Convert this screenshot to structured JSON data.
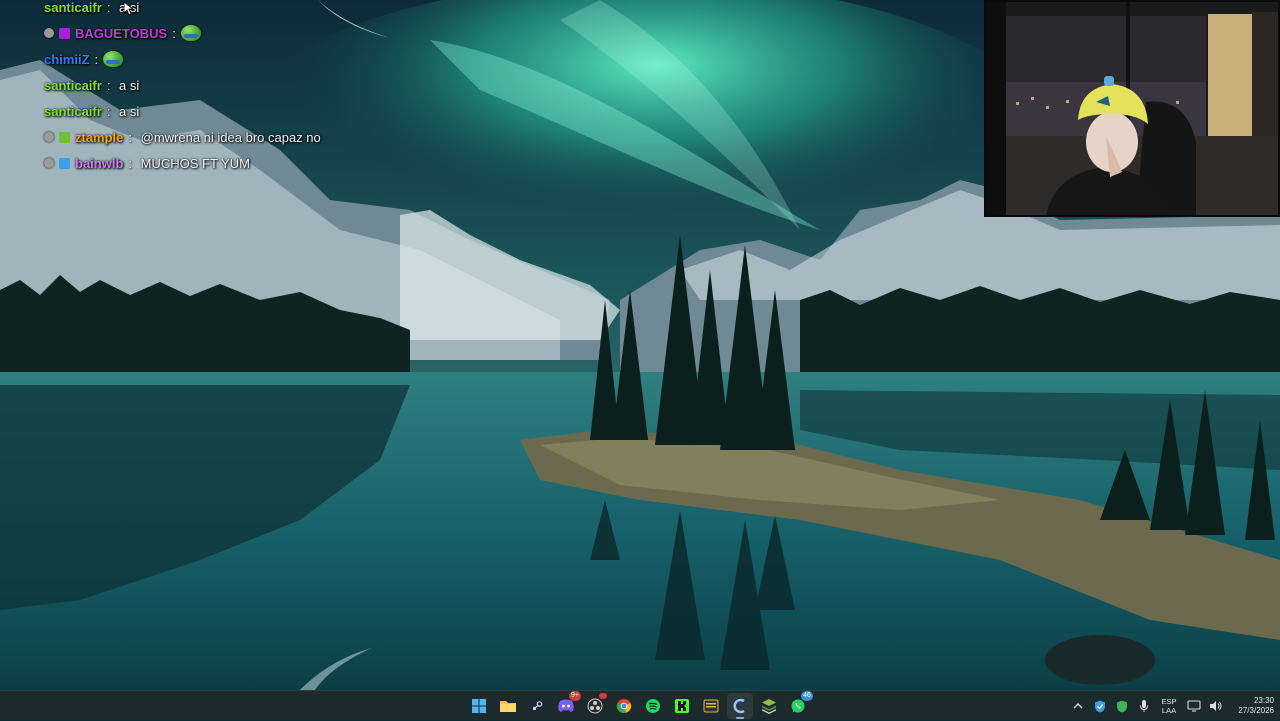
{
  "chat": {
    "lines": [
      {
        "user": "santicaifr",
        "user_color": "#7dde3c",
        "message": "a si",
        "badges": []
      },
      {
        "user": "BAGUETOBUS",
        "user_color": "#c03bd8",
        "message": "",
        "badges": [
          "dot",
          "purple"
        ],
        "emote": "pepe-emote"
      },
      {
        "user": "chimiiZ",
        "user_color": "#2f7bff",
        "message": "",
        "badges": [],
        "emote": "pepe-emote"
      },
      {
        "user": "santicaifr",
        "user_color": "#7dde3c",
        "message": "a si",
        "badges": []
      },
      {
        "user": "santicaifr",
        "user_color": "#7dde3c",
        "message": "a si",
        "badges": []
      },
      {
        "user": "ztample",
        "user_color": "#f2a60c",
        "message": "@mwrena ni idea bro capaz no",
        "badges": [
          "dot",
          "green"
        ]
      },
      {
        "user": "bainwlb",
        "user_color": "#d27bf0",
        "message": "MUCHOS FT YUM",
        "badges": [
          "dot",
          "blue"
        ]
      }
    ]
  },
  "taskbar": {
    "apps": [
      {
        "name": "windows-start-icon",
        "color": "#4fb3f5"
      },
      {
        "name": "file-explorer-icon",
        "color": "#f6c343"
      },
      {
        "name": "steam-icon",
        "color": "#cfd8dc"
      },
      {
        "name": "discord-icon",
        "color": "#7b5cf5",
        "badge": "9+"
      },
      {
        "name": "obs-icon",
        "color": "#cfcfcf",
        "badge": ""
      },
      {
        "name": "chrome-icon",
        "color": "#e94235"
      },
      {
        "name": "spotify-icon",
        "color": "#1ed760"
      },
      {
        "name": "kick-icon",
        "color": "#53fc18"
      },
      {
        "name": "notes-app-icon",
        "color": "#d9b34a"
      },
      {
        "name": "streamer-app-icon",
        "color": "#9fc3ff",
        "active": true
      },
      {
        "name": "stack-app-icon",
        "color": "#8bc34a"
      },
      {
        "name": "whatsapp-icon",
        "color": "#25d366",
        "badge": "46"
      }
    ],
    "tray": {
      "lang_top": "ESP",
      "lang_bottom": "LAA",
      "time": "23:30",
      "date": "27/3/2026"
    }
  }
}
